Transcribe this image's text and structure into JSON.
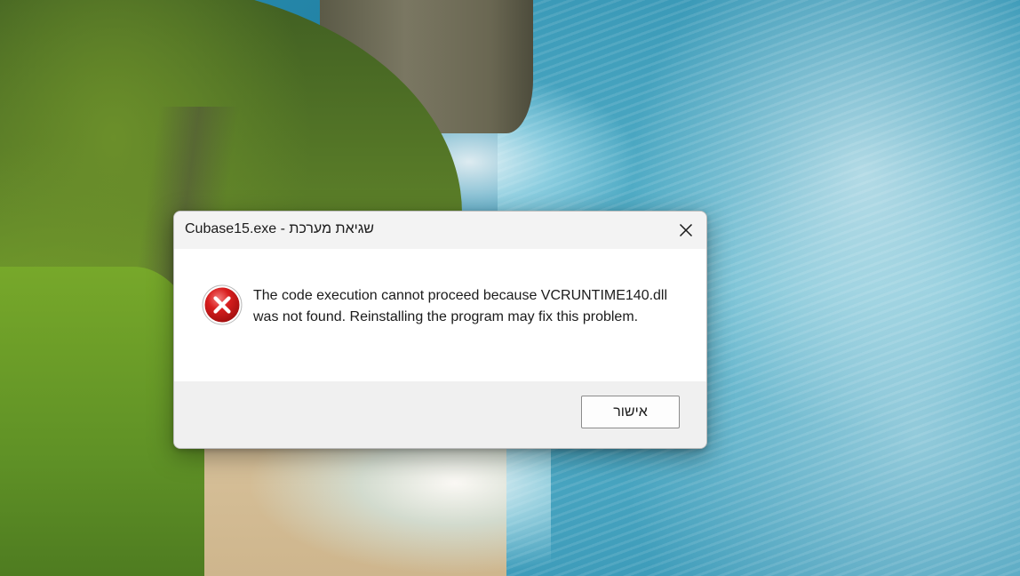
{
  "dialog": {
    "title": "Cubase15.exe - שגיאת מערכת",
    "message": "The code execution cannot proceed because VCRUNTIME140.dll was not found. Reinstalling the program may fix this problem.",
    "icon": "error-icon",
    "ok_label": "אישור",
    "close_icon": "close-icon"
  },
  "colors": {
    "error_red": "#d81e1e",
    "titlebar_bg": "#f3f3f3",
    "footer_bg": "#f0f0f0"
  }
}
